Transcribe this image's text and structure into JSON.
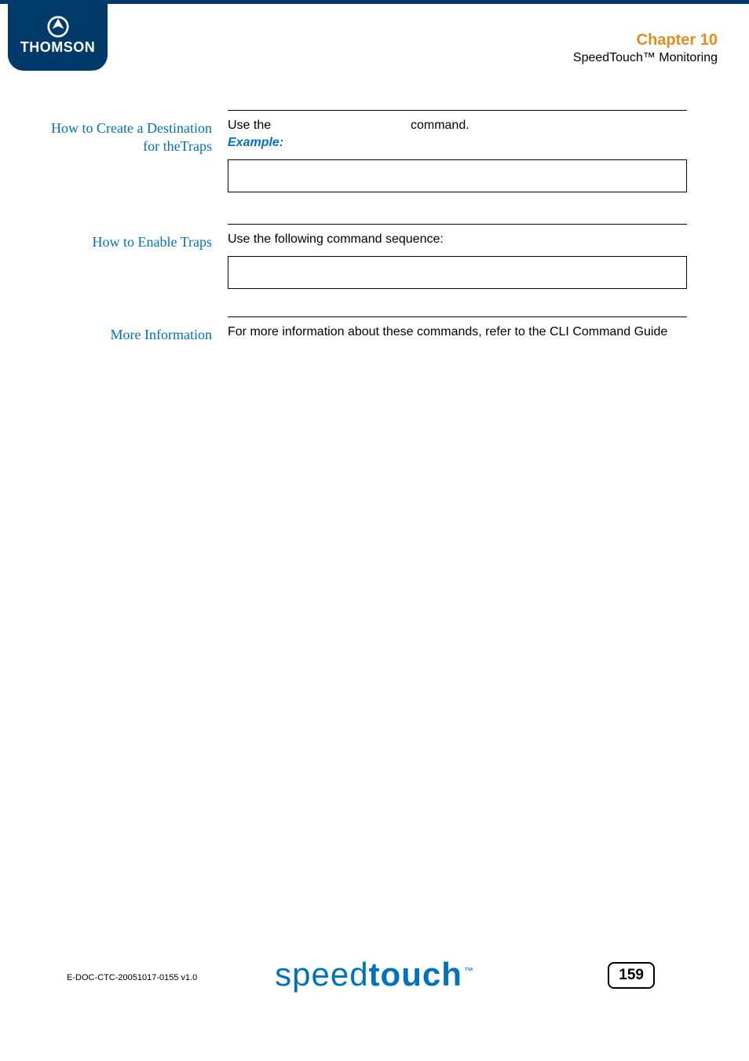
{
  "header": {
    "logo_text": "THOMSON",
    "chapter": "Chapter 10",
    "subtitle": "SpeedTouch™ Monitoring"
  },
  "sections": {
    "s1": {
      "heading": "How to Create a Destination for theTraps",
      "line_prefix": "Use the ",
      "line_suffix": "command.",
      "example_label": "Example:"
    },
    "s2": {
      "heading": "How to Enable Traps",
      "text": "Use the following command sequence:"
    },
    "s3": {
      "heading": "More Information",
      "text": "For more information about these commands, refer to the CLI Command Guide"
    }
  },
  "footer": {
    "doc_code": "E-DOC-CTC-20051017-0155 v1.0",
    "brand_thin": "speed",
    "brand_bold": "touch",
    "brand_tm": "™",
    "page": "159"
  }
}
